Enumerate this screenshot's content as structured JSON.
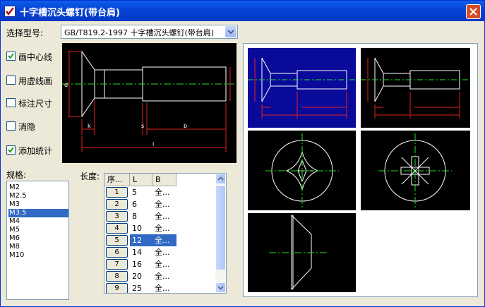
{
  "window": {
    "title": "十字槽沉头螺钉(带台肩)"
  },
  "model": {
    "label": "选择型号:",
    "value": "GB/T819.2-1997 十字槽沉头螺钉(带台肩)"
  },
  "options": [
    {
      "label": "画中心线",
      "checked": true
    },
    {
      "label": "用虚线画",
      "checked": false
    },
    {
      "label": "标注尺寸",
      "checked": false
    },
    {
      "label": "消隐",
      "checked": false
    },
    {
      "label": "添加统计",
      "checked": true
    }
  ],
  "spec": {
    "label": "规格:",
    "items": [
      "M2",
      "M2.5",
      "M3",
      "M3.5",
      "M4",
      "M5",
      "M6",
      "M8",
      "M10"
    ],
    "selected_index": 3
  },
  "length": {
    "label": "长度:",
    "columns": [
      "序...",
      "L",
      "B"
    ],
    "rows": [
      {
        "no": "1",
        "L": "5",
        "B": "全..."
      },
      {
        "no": "2",
        "L": "6",
        "B": "全..."
      },
      {
        "no": "3",
        "L": "8",
        "B": "全..."
      },
      {
        "no": "4",
        "L": "10",
        "B": "全..."
      },
      {
        "no": "5",
        "L": "12",
        "B": "全..."
      },
      {
        "no": "6",
        "L": "14",
        "B": "全..."
      },
      {
        "no": "7",
        "L": "16",
        "B": "全..."
      },
      {
        "no": "8",
        "L": "20",
        "B": "全..."
      },
      {
        "no": "9",
        "L": "25",
        "B": "全..."
      }
    ],
    "selected_index": 4
  },
  "drawing_labels": {
    "d": "d",
    "k": "k",
    "s": "s",
    "b": "b",
    "l": "l",
    "r": "r"
  },
  "gallery": {
    "selected_index": 0
  }
}
